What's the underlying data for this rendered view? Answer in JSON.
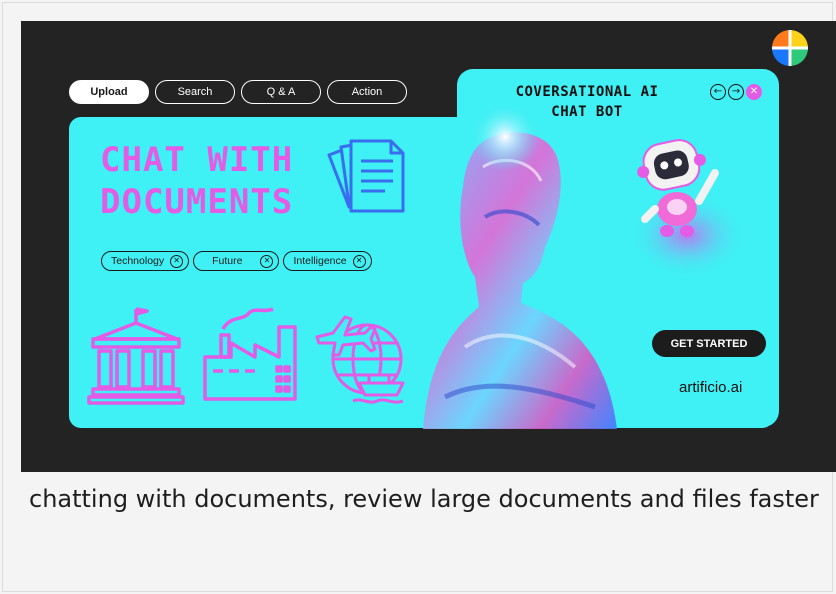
{
  "tabs": [
    {
      "label": "Upload",
      "active": true
    },
    {
      "label": "Search",
      "active": false
    },
    {
      "label": "Q & A",
      "active": false
    },
    {
      "label": "Action",
      "active": false
    }
  ],
  "hero": {
    "title": "CHAT WITH\nDOCUMENTS"
  },
  "right_panel": {
    "title": "COVERSATIONAL AI\nCHAT BOT"
  },
  "nav": {
    "prev": "←",
    "next": "→",
    "close": "✕"
  },
  "chips": [
    {
      "label": "Technology"
    },
    {
      "label": "Future"
    },
    {
      "label": "Intelligence"
    }
  ],
  "cta": {
    "label": "GET STARTED"
  },
  "brand": {
    "name": "artificio.ai"
  },
  "caption": {
    "text": "chatting with documents, review large documents and files faster"
  },
  "colors": {
    "background": "#232323",
    "panel": "#3ff0f4",
    "accent_pink": "#e45be6",
    "icon_blue": "#3a6cf0",
    "dark": "#1c1c1c"
  },
  "icons": [
    "document-stack-icon",
    "bank-building-icon",
    "factory-icon",
    "globe-travel-icon",
    "robot-mascot",
    "app-logo"
  ]
}
